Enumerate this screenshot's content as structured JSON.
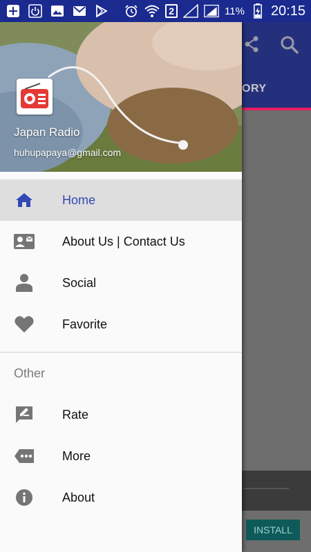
{
  "status_bar": {
    "sim_indicator": "2",
    "battery": "11%",
    "time": "20:15"
  },
  "app": {
    "tab_partial": "ORY",
    "install_label": "INSTALL"
  },
  "drawer": {
    "app_title": "Japan Radio",
    "email": "huhupapaya@gmail.com",
    "items": [
      {
        "label": "Home",
        "icon": "home-icon",
        "active": true
      },
      {
        "label": "About Us | Contact Us",
        "icon": "contact-card-icon"
      },
      {
        "label": "Social",
        "icon": "person-icon"
      },
      {
        "label": "Favorite",
        "icon": "heart-icon"
      }
    ],
    "section_other": "Other",
    "other_items": [
      {
        "label": "Rate",
        "icon": "rate-review-icon"
      },
      {
        "label": "More",
        "icon": "more-tag-icon"
      },
      {
        "label": "About",
        "icon": "info-icon"
      }
    ]
  },
  "colors": {
    "status_bar": "#1b2a8f",
    "toolbar": "#25307d",
    "tab_indicator": "#e91e63",
    "active_text": "#3348b5",
    "icon_grey": "#757575"
  }
}
